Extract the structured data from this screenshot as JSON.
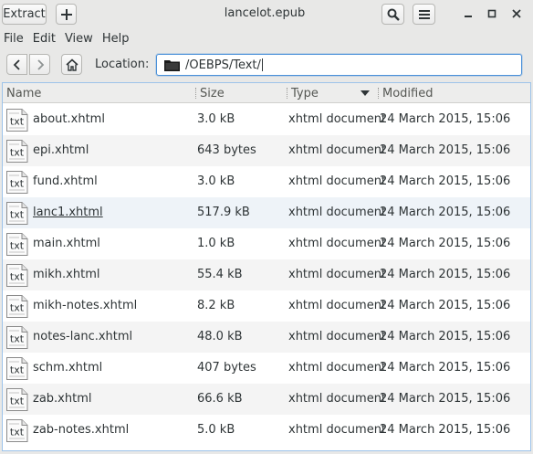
{
  "titlebar": {
    "extract_label": "Extract",
    "title": "lancelot.epub"
  },
  "menubar": [
    "File",
    "Edit",
    "View",
    "Help"
  ],
  "location": {
    "label": "Location:",
    "path": "/OEBPS/Text/"
  },
  "columns": {
    "name": "Name",
    "size": "Size",
    "type": "Type",
    "modified": "Modified"
  },
  "icon_text": "txt",
  "files": [
    {
      "name": "about.xhtml",
      "size": "3.0 kB",
      "type": "xhtml document",
      "modified": "24 March 2015, 15:06"
    },
    {
      "name": "epi.xhtml",
      "size": "643 bytes",
      "type": "xhtml document",
      "modified": "24 March 2015, 15:06"
    },
    {
      "name": "fund.xhtml",
      "size": "3.0 kB",
      "type": "xhtml document",
      "modified": "24 March 2015, 15:06"
    },
    {
      "name": "lanc1.xhtml",
      "size": "517.9 kB",
      "type": "xhtml document",
      "modified": "24 March 2015, 15:06"
    },
    {
      "name": "main.xhtml",
      "size": "1.0 kB",
      "type": "xhtml document",
      "modified": "24 March 2015, 15:06"
    },
    {
      "name": "mikh.xhtml",
      "size": "55.4 kB",
      "type": "xhtml document",
      "modified": "24 March 2015, 15:06"
    },
    {
      "name": "mikh-notes.xhtml",
      "size": "8.2 kB",
      "type": "xhtml document",
      "modified": "24 March 2015, 15:06"
    },
    {
      "name": "notes-lanc.xhtml",
      "size": "48.0 kB",
      "type": "xhtml document",
      "modified": "24 March 2015, 15:06"
    },
    {
      "name": "schm.xhtml",
      "size": "407 bytes",
      "type": "xhtml document",
      "modified": "24 March 2015, 15:06"
    },
    {
      "name": "zab.xhtml",
      "size": "66.6 kB",
      "type": "xhtml document",
      "modified": "24 March 2015, 15:06"
    },
    {
      "name": "zab-notes.xhtml",
      "size": "5.0 kB",
      "type": "xhtml document",
      "modified": "24 March 2015, 15:06"
    }
  ],
  "icons": {
    "add": "plus-icon",
    "search": "search-icon",
    "menu": "hamburger-menu-icon",
    "minimize": "minimize-icon",
    "maximize": "maximize-icon",
    "close": "close-icon",
    "back": "chevron-left-icon",
    "forward": "chevron-right-icon",
    "home": "home-icon",
    "folder": "folder-icon",
    "file": "text-file-icon",
    "sort": "sort-descending-icon"
  },
  "colors": {
    "focus_border": "#4a90d9",
    "hover_row": "#eef3f8",
    "alt_row": "#f4f4f4"
  }
}
